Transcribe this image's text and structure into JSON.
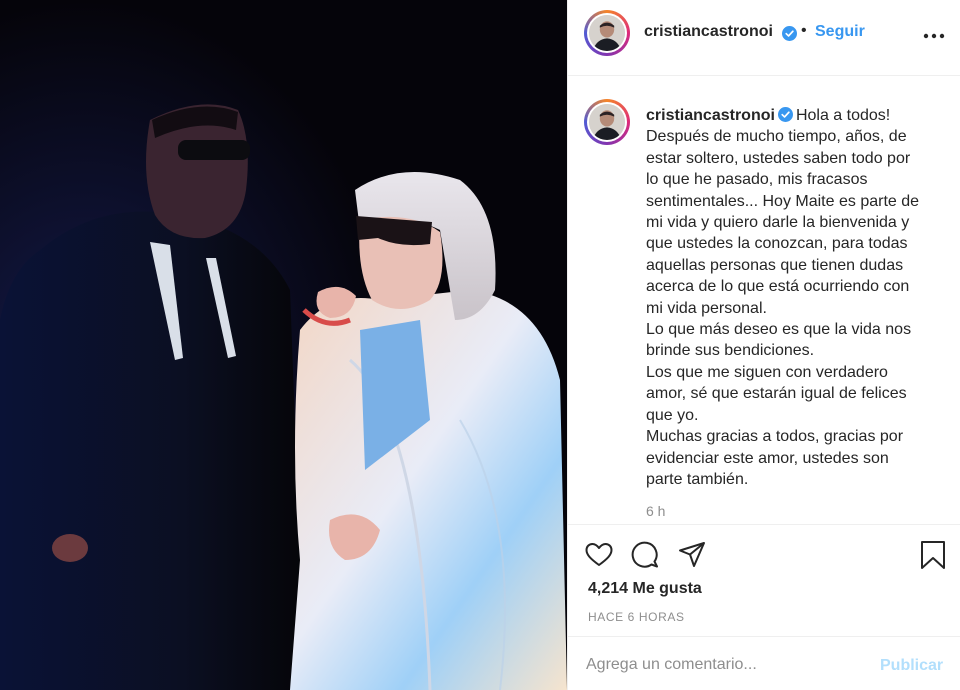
{
  "header": {
    "username": "cristiancastronoi",
    "separator": "•",
    "follow_label": "Seguir",
    "more_icon": "more-horizontal-icon",
    "verified_icon": "verified-badge-icon"
  },
  "caption": {
    "username": "cristiancastronoi",
    "lines": [
      "Hola a todos!",
      "Después de mucho tiempo, años, de",
      "estar soltero, ustedes saben todo por",
      "lo que he pasado, mis fracasos",
      "sentimentales... Hoy Maite es parte de",
      "mi vida y quiero darle la bienvenida y",
      "que ustedes la conozcan, para todas",
      "aquellas personas que tienen dudas",
      "acerca de lo que está ocurriendo con",
      "mi vida personal.",
      "Lo que más deseo es que la vida nos",
      "brinde sus bendiciones.",
      "Los que me siguen con verdadero",
      "amor, sé que estarán igual de felices",
      "que yo.",
      "Muchas gracias a todos, gracias por",
      "evidenciar este amor, ustedes son",
      "parte también."
    ],
    "time_ago": "6 h"
  },
  "actions": {
    "icons": [
      "heart-icon",
      "comment-icon",
      "share-icon",
      "bookmark-icon"
    ],
    "likes": "4,214 Me gusta",
    "timestamp": "HACE 6 HORAS"
  },
  "comment": {
    "placeholder": "Agrega un comentario...",
    "publish_label": "Publicar"
  },
  "colors": {
    "link_blue": "#3897f0",
    "publish_disabled": "#b2dffc",
    "text": "#262626",
    "muted": "#8e8e8e",
    "divider": "#efefef"
  }
}
